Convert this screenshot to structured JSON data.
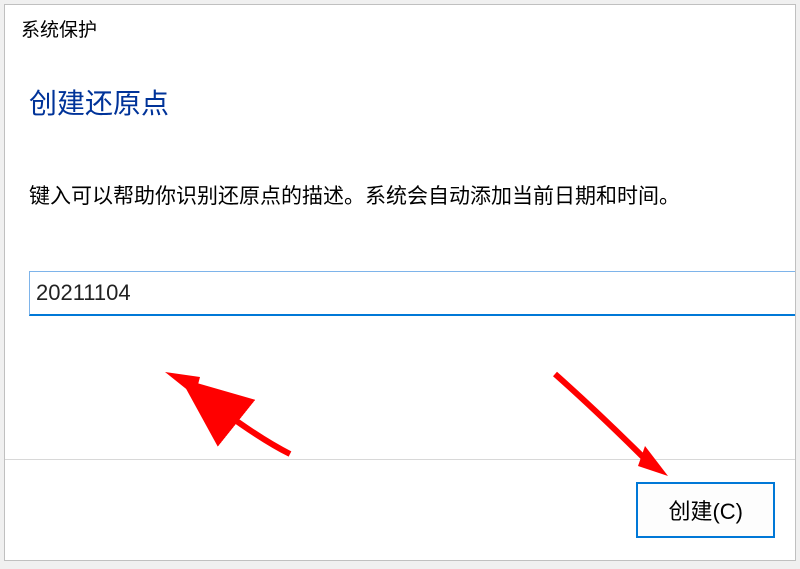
{
  "dialog": {
    "title": "系统保护",
    "heading": "创建还原点",
    "instruction": "键入可以帮助你识别还原点的描述。系统会自动添加当前日期和时间。"
  },
  "input": {
    "value": "20211104"
  },
  "buttons": {
    "create_label": "创建(C)"
  },
  "annotations": {
    "arrow_color": "#ff0000"
  }
}
